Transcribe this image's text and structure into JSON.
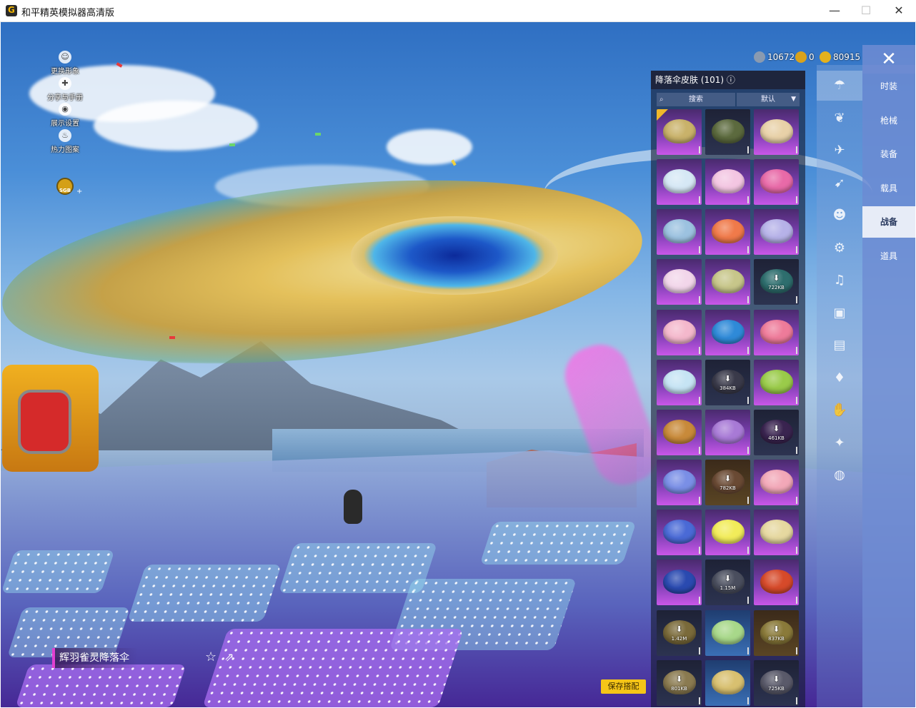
{
  "window": {
    "title": "和平精英模拟器高清版",
    "min": "—",
    "max": "☐",
    "close": "✕"
  },
  "quick_menu": [
    {
      "label": "更换形象",
      "icon": "person-icon",
      "glyph": "☺"
    },
    {
      "label": "分享与手册",
      "icon": "share-gear-icon",
      "glyph": "✚"
    },
    {
      "label": "展示设置",
      "icon": "eye-icon",
      "glyph": "◉"
    },
    {
      "label": "热力图案",
      "icon": "fire-icon",
      "glyph": "♨"
    }
  ],
  "sgb_badge": "SGB",
  "currency": [
    {
      "value": "10672",
      "icon": "diamond-coin-icon",
      "color": "#8a9ab0"
    },
    {
      "value": "0",
      "icon": "gold-medal-icon",
      "color": "#d9a21b"
    },
    {
      "value": "80915",
      "icon": "gold-coin-icon",
      "color": "#e4b11d"
    }
  ],
  "panel": {
    "title": "降落伞皮肤 (101)",
    "search_placeholder": "搜索",
    "sort_label": "默认",
    "items": [
      {
        "style": "purple",
        "chute": "#c9b26a",
        "selected": true,
        "size": ""
      },
      {
        "style": "dark",
        "chute": "#5c6a3e",
        "selected": false,
        "size": ""
      },
      {
        "style": "purple",
        "chute": "#e8d1a8",
        "selected": false,
        "size": ""
      },
      {
        "style": "purple",
        "chute": "#d6e8f5",
        "selected": false,
        "size": ""
      },
      {
        "style": "purple",
        "chute": "#f3c6e2",
        "selected": false,
        "size": ""
      },
      {
        "style": "purple",
        "chute": "#e86aa8",
        "selected": false,
        "size": ""
      },
      {
        "style": "purple",
        "chute": "#9cc2e0",
        "selected": false,
        "size": ""
      },
      {
        "style": "purple",
        "chute": "#f07a4a",
        "selected": false,
        "size": ""
      },
      {
        "style": "purple",
        "chute": "#b6b2e8",
        "selected": false,
        "size": ""
      },
      {
        "style": "purple",
        "chute": "#f2d6ea",
        "selected": false,
        "size": ""
      },
      {
        "style": "purple",
        "chute": "#c7c68a",
        "selected": false,
        "size": ""
      },
      {
        "style": "dark",
        "chute": "#2e6e6e",
        "selected": false,
        "size": "722KB",
        "download": true
      },
      {
        "style": "purple",
        "chute": "#f4b8cc",
        "selected": false,
        "size": ""
      },
      {
        "style": "purple",
        "chute": "#2f8ad8",
        "selected": false,
        "size": ""
      },
      {
        "style": "purple",
        "chute": "#ee7b9a",
        "selected": false,
        "size": ""
      },
      {
        "style": "purple",
        "chute": "#c6e4f4",
        "selected": false,
        "size": ""
      },
      {
        "style": "dark",
        "chute": "#3a3a4a",
        "selected": false,
        "size": "384KB",
        "download": true
      },
      {
        "style": "purple",
        "chute": "#9acb4a",
        "selected": false,
        "size": ""
      },
      {
        "style": "purple",
        "chute": "#c88a3a",
        "selected": false,
        "size": ""
      },
      {
        "style": "purple",
        "chute": "#a87ad6",
        "selected": false,
        "size": ""
      },
      {
        "style": "dark",
        "chute": "#3a2450",
        "selected": false,
        "size": "461KB",
        "download": true
      },
      {
        "style": "purple",
        "chute": "#7a8fe6",
        "selected": false,
        "size": ""
      },
      {
        "style": "gold",
        "chute": "#6a4a34",
        "selected": false,
        "size": "782KB",
        "download": true
      },
      {
        "style": "purple",
        "chute": "#f2a8b8",
        "selected": false,
        "size": ""
      },
      {
        "style": "purple",
        "chute": "#4a6ad6",
        "selected": false,
        "size": ""
      },
      {
        "style": "purple",
        "chute": "#f2ec5a",
        "selected": false,
        "size": ""
      },
      {
        "style": "purple",
        "chute": "#e6d8a0",
        "selected": false,
        "size": ""
      },
      {
        "style": "purple",
        "chute": "#2a4ab0",
        "selected": false,
        "size": ""
      },
      {
        "style": "dark",
        "chute": "#4a4e5e",
        "selected": false,
        "size": "1.15M",
        "download": true
      },
      {
        "style": "purple",
        "chute": "#d64a2a",
        "selected": false,
        "size": ""
      },
      {
        "style": "dark",
        "chute": "#7a6a3a",
        "selected": false,
        "size": "1.42M",
        "download": true
      },
      {
        "style": "blue",
        "chute": "#a8d88a",
        "selected": false,
        "size": ""
      },
      {
        "style": "gold",
        "chute": "#8a7a3a",
        "selected": false,
        "size": "837KB",
        "download": true
      },
      {
        "style": "dark",
        "chute": "#8a7a50",
        "selected": false,
        "size": "801KB",
        "download": true
      },
      {
        "style": "blue",
        "chute": "#d8c070",
        "selected": false,
        "size": ""
      },
      {
        "style": "dark",
        "chute": "#5a5a6a",
        "selected": false,
        "size": "725KB",
        "download": true
      }
    ]
  },
  "icon_tabs": [
    {
      "icon": "parachute-icon",
      "glyph": "☂",
      "active": true
    },
    {
      "icon": "wings-icon",
      "glyph": "❦",
      "active": false
    },
    {
      "icon": "plane-icon",
      "glyph": "✈",
      "active": false
    },
    {
      "icon": "glider-icon",
      "glyph": "➹",
      "active": false
    },
    {
      "icon": "emote-icon",
      "glyph": "☻",
      "active": false
    },
    {
      "icon": "robot-icon",
      "glyph": "⚙",
      "active": false
    },
    {
      "icon": "speaker-icon",
      "glyph": "♫",
      "active": false
    },
    {
      "icon": "mask-icon",
      "glyph": "▣",
      "active": false
    },
    {
      "icon": "photo-icon",
      "glyph": "▤",
      "active": false
    },
    {
      "icon": "spray-icon",
      "glyph": "♦",
      "active": false
    },
    {
      "icon": "hand-icon",
      "glyph": "✋",
      "active": false
    },
    {
      "icon": "wand-icon",
      "glyph": "✦",
      "active": false
    },
    {
      "icon": "planet-icon",
      "glyph": "◍",
      "active": false
    }
  ],
  "categories": [
    {
      "label": "时装",
      "active": false
    },
    {
      "label": "枪械",
      "active": false
    },
    {
      "label": "装备",
      "active": false
    },
    {
      "label": "载具",
      "active": false
    },
    {
      "label": "战备",
      "active": true
    },
    {
      "label": "道具",
      "active": false
    }
  ],
  "close_glyph": "✕",
  "item_name": "辉羽雀灵降落伞",
  "fav_glyph": "☆",
  "share_glyph": "⇗",
  "save_button": "保存搭配"
}
